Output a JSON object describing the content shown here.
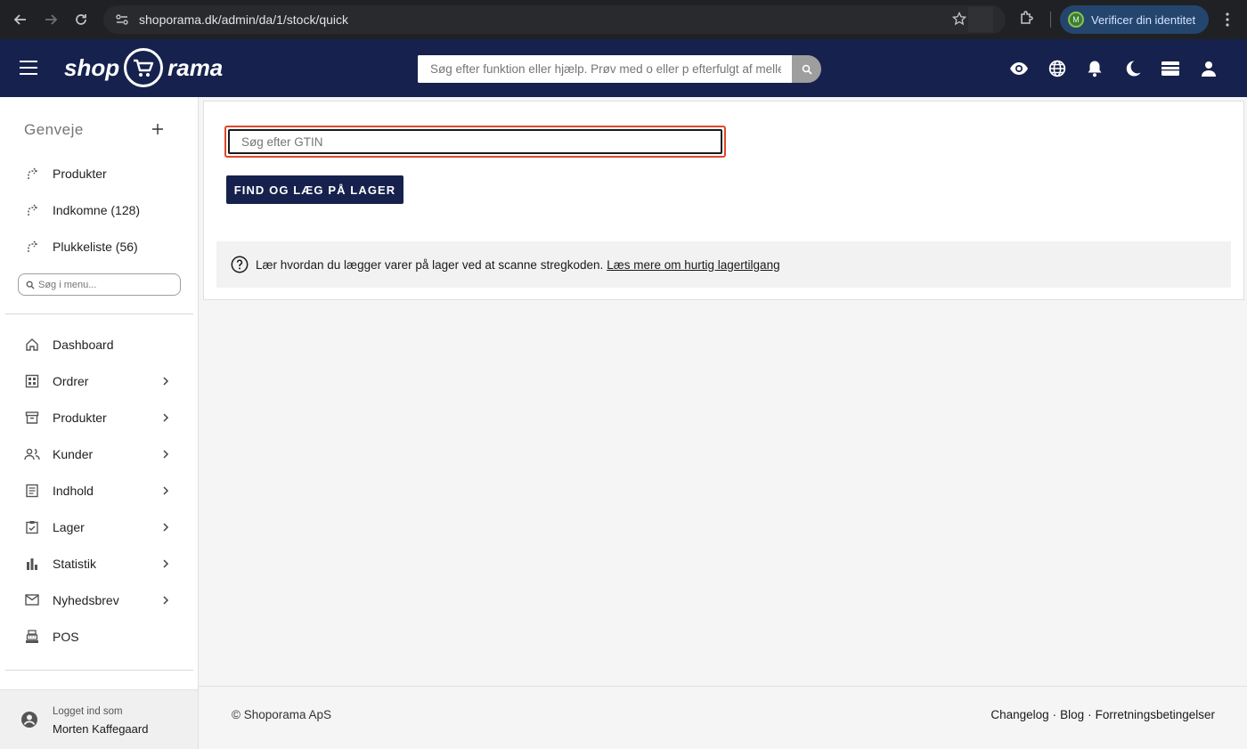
{
  "browser": {
    "url": "shoporama.dk/admin/da/1/stock/quick",
    "verify_label": "Verificer din identitet",
    "profile_initial": "M"
  },
  "header": {
    "logo_left": "shop",
    "logo_right": "rama",
    "search_placeholder": "Søg efter funktion eller hjælp. Prøv med o eller p efterfulgt af mellemrum",
    "icons": [
      "eye-icon",
      "globe-icon",
      "bell-icon",
      "moon-icon",
      "credit-card-icon",
      "user-icon"
    ]
  },
  "sidebar": {
    "shortcuts_title": "Genveje",
    "shortcuts": [
      {
        "label": "Produkter"
      },
      {
        "label": "Indkomne (128)"
      },
      {
        "label": "Plukkeliste (56)"
      }
    ],
    "menu_search_placeholder": "Søg i menu...",
    "menu": [
      {
        "label": "Dashboard",
        "icon": "home-icon",
        "has_children": false
      },
      {
        "label": "Ordrer",
        "icon": "grid-icon",
        "has_children": true
      },
      {
        "label": "Produkter",
        "icon": "archive-icon",
        "has_children": true
      },
      {
        "label": "Kunder",
        "icon": "people-icon",
        "has_children": true
      },
      {
        "label": "Indhold",
        "icon": "document-icon",
        "has_children": true
      },
      {
        "label": "Lager",
        "icon": "clipboard-check-icon",
        "has_children": true
      },
      {
        "label": "Statistik",
        "icon": "bar-chart-icon",
        "has_children": true
      },
      {
        "label": "Nyhedsbrev",
        "icon": "mail-icon",
        "has_children": true
      },
      {
        "label": "POS",
        "icon": "cash-register-icon",
        "has_children": false
      }
    ],
    "logged_in_label": "Logget ind som",
    "user_name": "Morten Kaffegaard"
  },
  "main": {
    "gtin_placeholder": "Søg efter GTIN",
    "find_button": "FIND OG LÆG PÅ LAGER",
    "help_text": "Lær hvordan du lægger varer på lager ved at scanne stregkoden.",
    "help_link": "Læs mere om hurtig lagertilgang"
  },
  "footer": {
    "copyright": "© Shoporama ApS",
    "links": [
      "Changelog",
      "Blog",
      "Forretningsbetingelser"
    ]
  },
  "colors": {
    "brand_navy": "#16224d",
    "focus_ring": "#e0462c"
  }
}
